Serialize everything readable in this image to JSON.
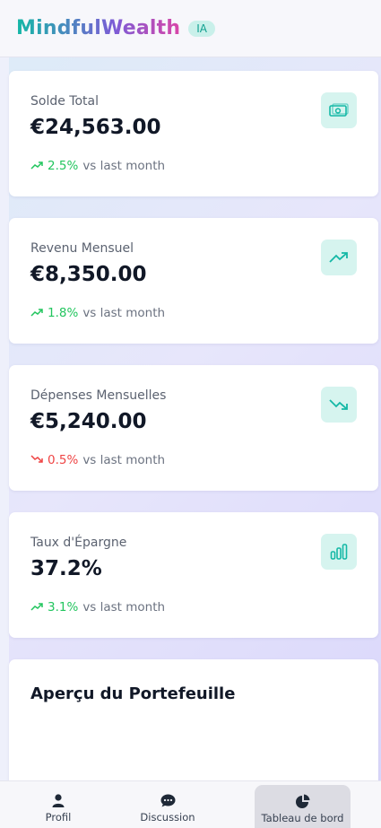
{
  "header": {
    "app_name": "MindfulWealth",
    "badge": "IA"
  },
  "metrics": [
    {
      "label": "Solde Total",
      "value": "€24,563.00",
      "change": "2.5%",
      "direction": "up",
      "suffix": "vs last month",
      "icon": "banknote-icon"
    },
    {
      "label": "Revenu Mensuel",
      "value": "€8,350.00",
      "change": "1.8%",
      "direction": "up",
      "suffix": "vs last month",
      "icon": "trending-up-icon"
    },
    {
      "label": "Dépenses Mensuelles",
      "value": "€5,240.00",
      "change": "0.5%",
      "direction": "down",
      "suffix": "vs last month",
      "icon": "trending-down-icon"
    },
    {
      "label": "Taux d'Épargne",
      "value": "37.2%",
      "change": "3.1%",
      "direction": "up",
      "suffix": "vs last month",
      "icon": "bar-chart-icon"
    }
  ],
  "portfolio": {
    "title": "Aperçu du Portefeuille"
  },
  "nav": [
    {
      "label": "Profil",
      "icon": "user-icon",
      "active": false
    },
    {
      "label": "Discussion",
      "icon": "chat-bubble-icon",
      "active": false
    },
    {
      "label": "Tableau de bord",
      "icon": "pie-chart-icon",
      "active": true
    }
  ],
  "colors": {
    "accent": "#14b8a6",
    "up": "#22c55e",
    "down": "#ef4444",
    "icon_bg": "#d6f4ef"
  }
}
